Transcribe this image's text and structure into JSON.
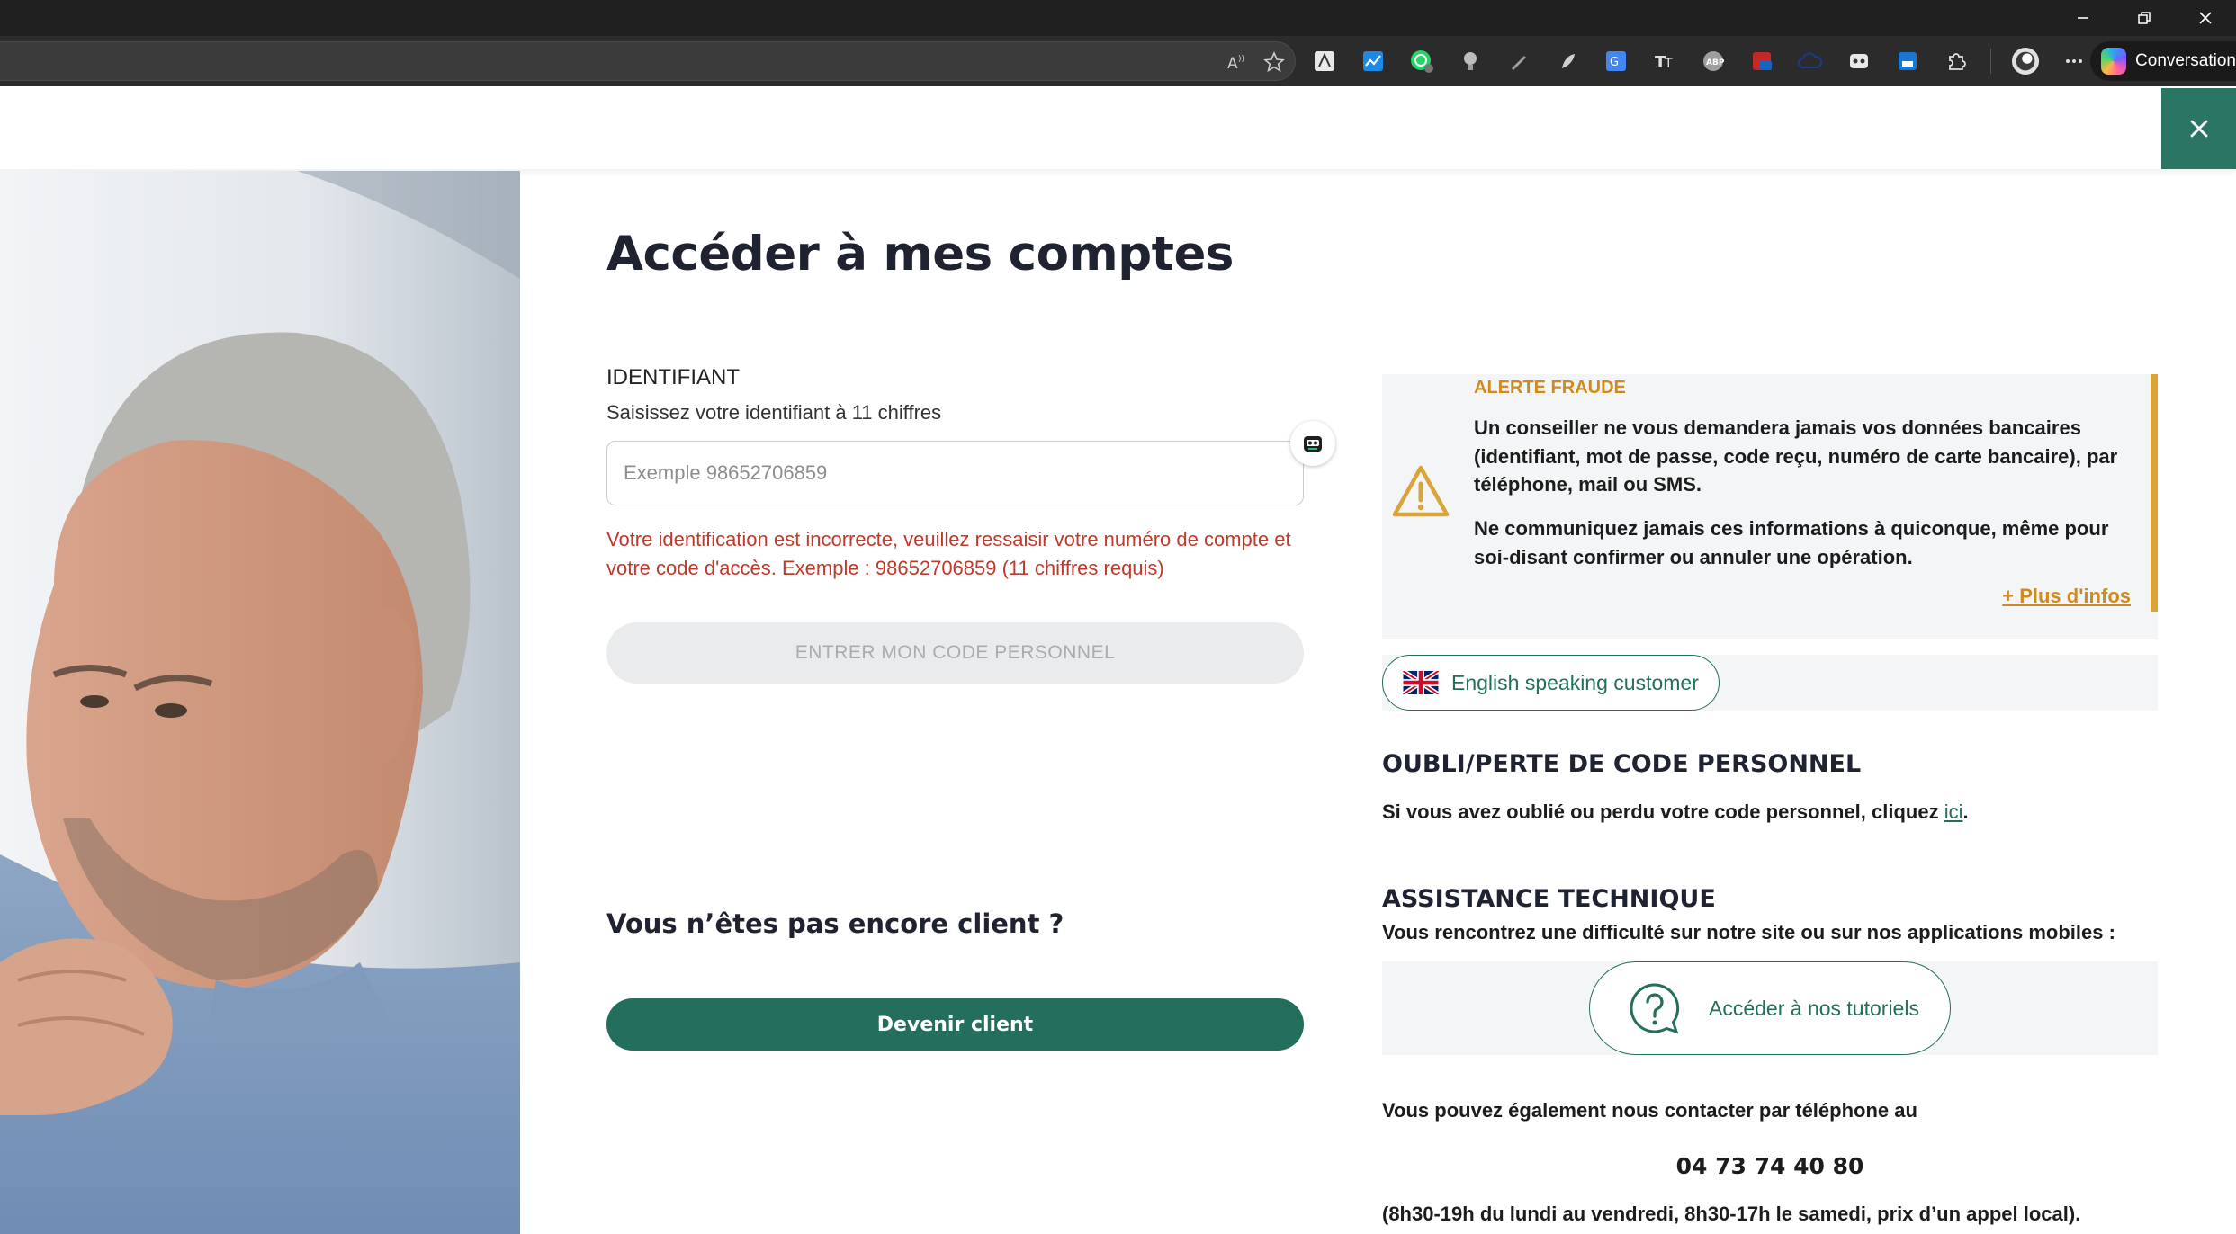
{
  "browser": {
    "copilot_label": "Conversation",
    "extension_icons": [
      "read-aloud-icon",
      "favorite-star-icon",
      "extension-a-icon",
      "chart-extension-icon",
      "whatsapp-extension-icon",
      "lightbulb-extension-icon",
      "pen-extension-icon",
      "feather-extension-icon",
      "translate-extension-icon",
      "text-extension-icon",
      "adblock-extension-icon",
      "calendar-extension-icon",
      "cloud-extension-icon",
      "robot-extension-icon",
      "blue-extension-icon",
      "puzzle-extensions-icon",
      "profile-avatar-icon",
      "more-menu-icon"
    ]
  },
  "colors": {
    "brand_green": "#236e5d",
    "close_green": "#2a7564",
    "error_red": "#c0392b",
    "fraud_orange": "#d08b1e"
  },
  "login": {
    "title": "Accéder à mes comptes",
    "id_label": "IDENTIFIANT",
    "id_hint": "Saisissez votre identifiant à 11 chiffres",
    "id_placeholder": "Exemple 98652706859",
    "id_value": "",
    "error_message": "Votre identification est incorrecte, veuillez ressaisir votre numéro de compte et votre code d'accès. Exemple : 98652706859 (11 chiffres requis)",
    "submit_label": "ENTRER MON CODE PERSONNEL",
    "prospect_title": "Vous n’êtes pas encore client ?",
    "become_client_label": "Devenir client"
  },
  "fraud": {
    "title": "ALERTE FRAUDE",
    "paragraph1": "Un conseiller ne vous demandera jamais vos données bancaires (identifiant, mot de passe, code reçu, numéro de carte bancaire), par téléphone, mail ou SMS.",
    "paragraph2": "Ne communiquez jamais ces informations à quiconque, même pour soi-disant confirmer ou annuler une opération.",
    "more_link": "+ Plus d'infos"
  },
  "english": {
    "label": "English speaking customer"
  },
  "forgot": {
    "title": "OUBLI/PERTE DE CODE PERSONNEL",
    "text": "Si vous avez oublié ou perdu votre code personnel, cliquez ",
    "link": "ici",
    "suffix": "."
  },
  "assistance": {
    "title": "ASSISTANCE TECHNIQUE",
    "text": "Vous rencontrez une difficulté sur notre site ou sur nos applications mobiles :",
    "tutorial_label": "Accéder à nos tutoriels"
  },
  "contact": {
    "intro": "Vous pouvez également nous contacter par téléphone au",
    "phone": "04 73 74 40 80",
    "hours": "(8h30-19h du lundi au vendredi, 8h30-17h le samedi, prix d’un appel local)."
  }
}
